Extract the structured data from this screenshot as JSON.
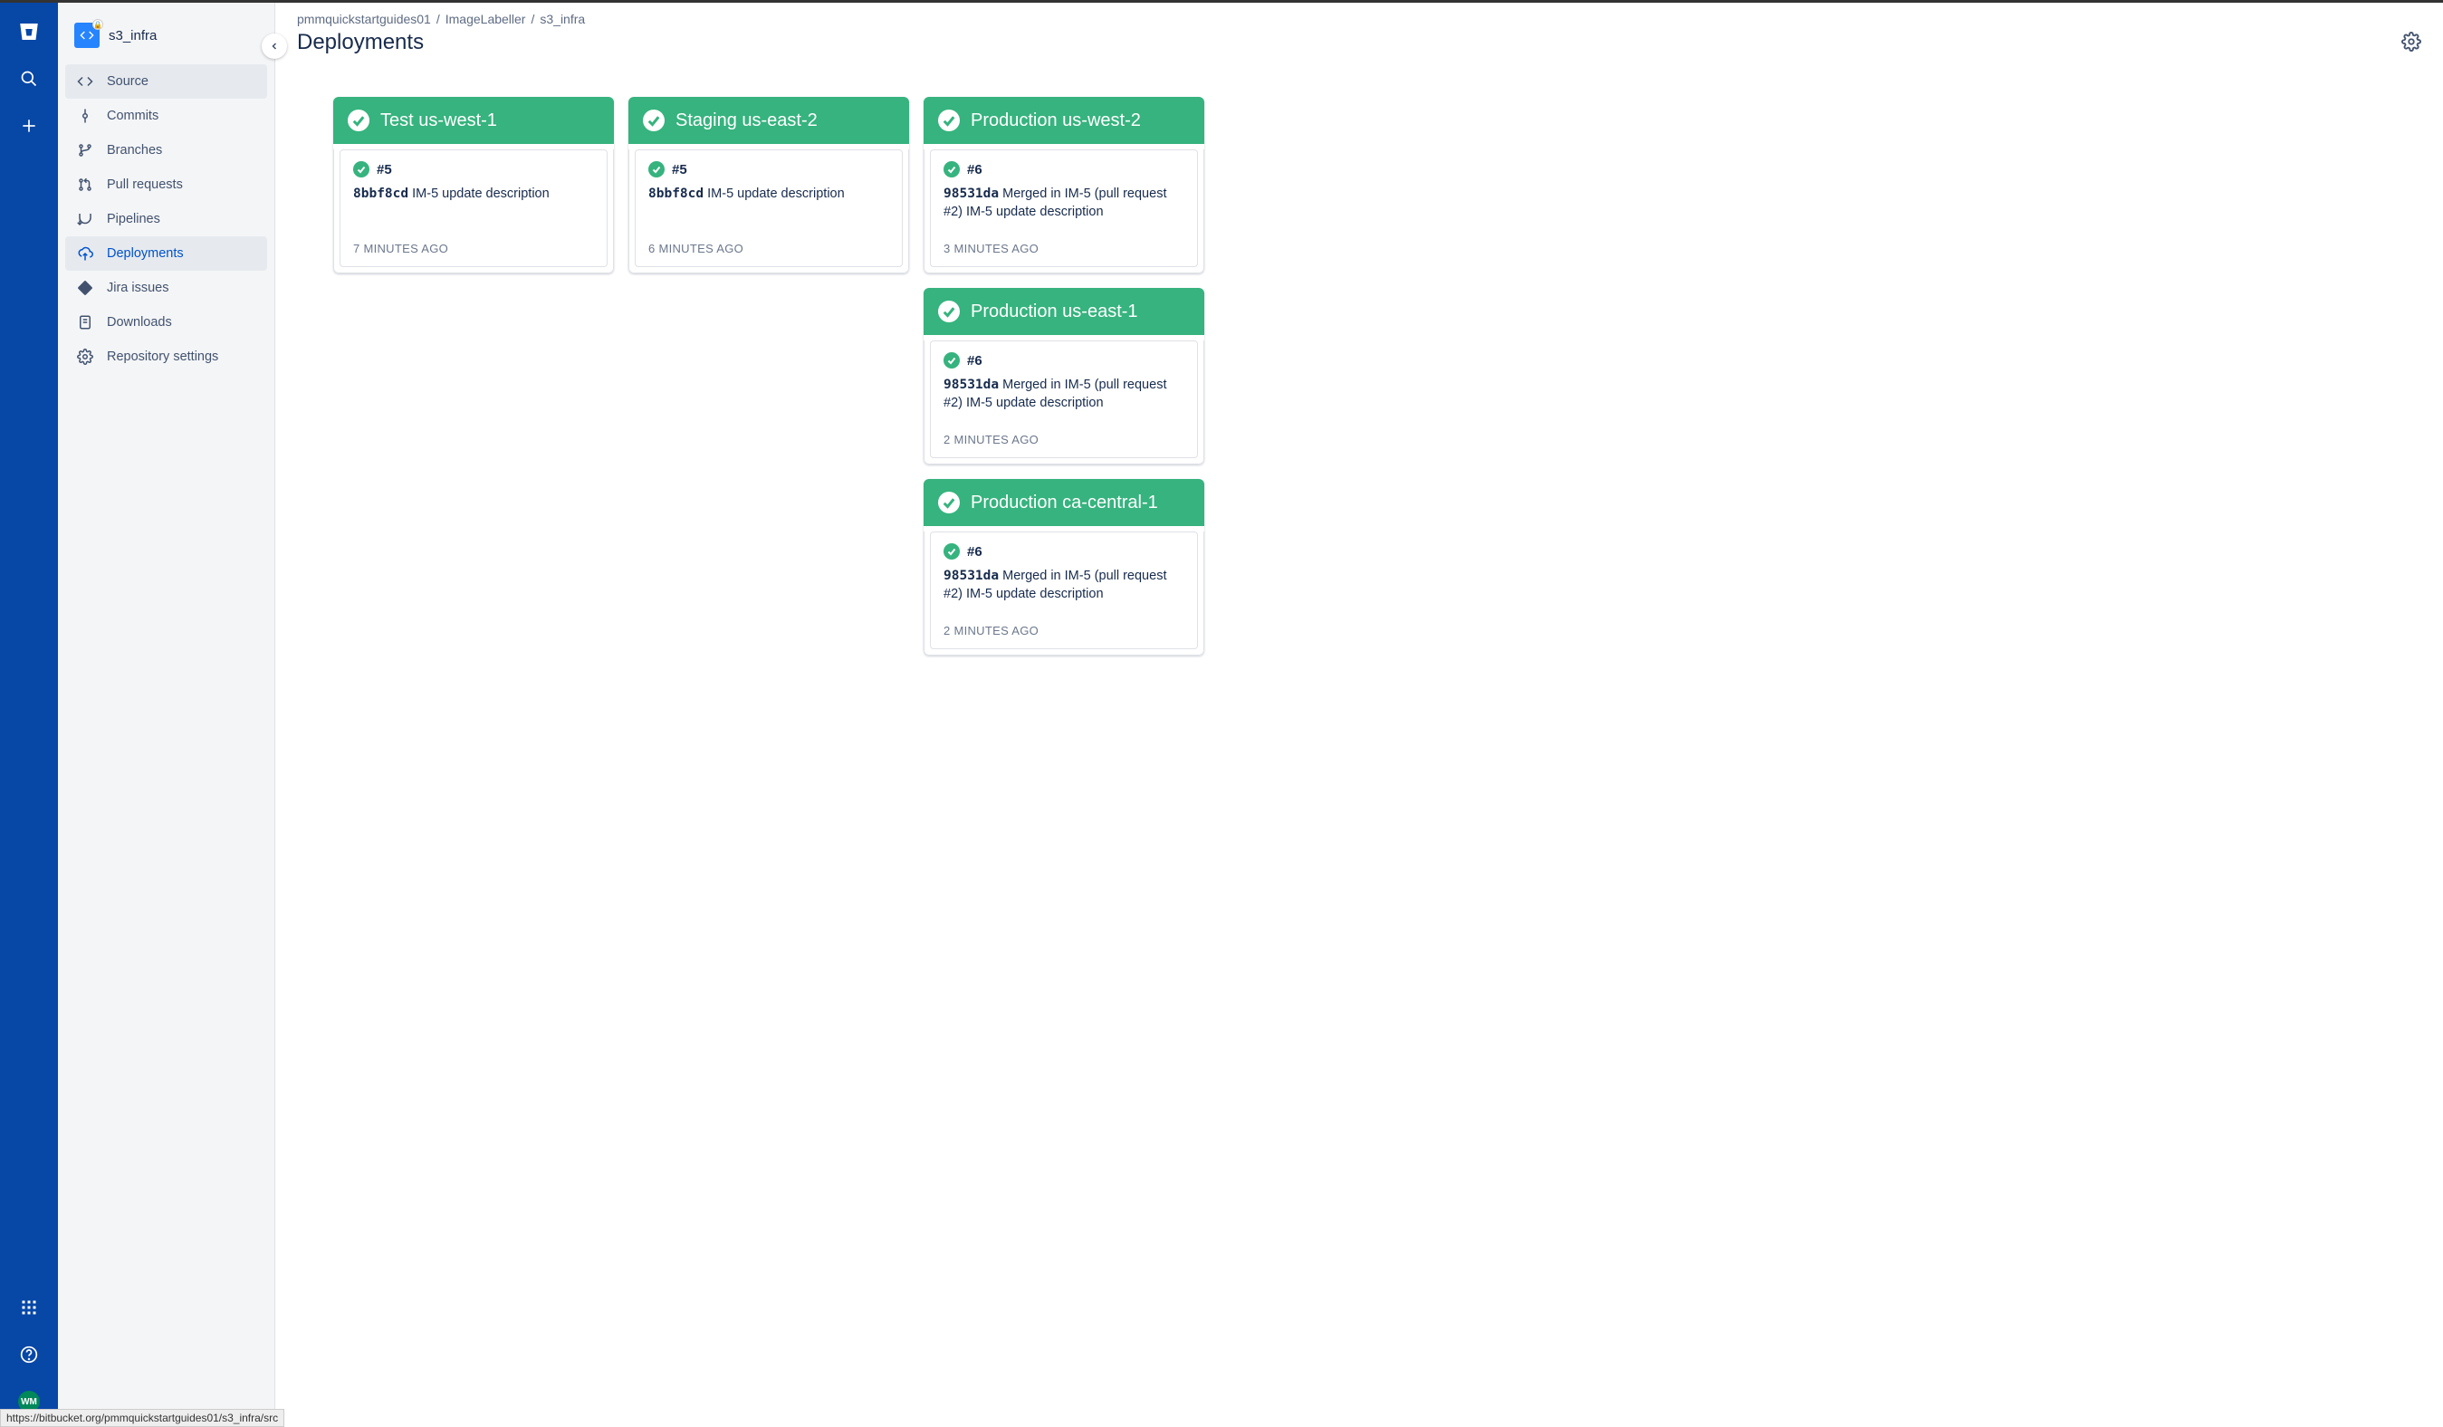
{
  "global_nav": {
    "avatar_initials": "WM"
  },
  "sidebar": {
    "repo_name": "s3_infra",
    "items": [
      {
        "label": "Source",
        "icon": "code"
      },
      {
        "label": "Commits",
        "icon": "commit"
      },
      {
        "label": "Branches",
        "icon": "branch"
      },
      {
        "label": "Pull requests",
        "icon": "pr"
      },
      {
        "label": "Pipelines",
        "icon": "pipeline"
      },
      {
        "label": "Deployments",
        "icon": "deploy"
      },
      {
        "label": "Jira issues",
        "icon": "jira"
      },
      {
        "label": "Downloads",
        "icon": "download"
      },
      {
        "label": "Repository settings",
        "icon": "gear"
      }
    ]
  },
  "breadcrumb": {
    "parts": [
      "pmmquickstartguides01",
      "ImageLabeller",
      "s3_infra"
    ]
  },
  "page": {
    "title": "Deployments"
  },
  "columns": [
    {
      "envs": [
        {
          "name": "Test us-west-1",
          "build": "#5",
          "hash": "8bbf8cd",
          "message": "IM-5 update description",
          "time": "7 MINUTES AGO"
        }
      ]
    },
    {
      "envs": [
        {
          "name": "Staging us-east-2",
          "build": "#5",
          "hash": "8bbf8cd",
          "message": "IM-5 update description",
          "time": "6 MINUTES AGO"
        }
      ]
    },
    {
      "envs": [
        {
          "name": "Production us-west-2",
          "build": "#6",
          "hash": "98531da",
          "message": "Merged in IM-5 (pull request #2) IM-5 update description",
          "time": "3 MINUTES AGO"
        },
        {
          "name": "Production us-east-1",
          "build": "#6",
          "hash": "98531da",
          "message": "Merged in IM-5 (pull request #2) IM-5 update description",
          "time": "2 MINUTES AGO"
        },
        {
          "name": "Production ca-central-1",
          "build": "#6",
          "hash": "98531da",
          "message": "Merged in IM-5 (pull request #2) IM-5 update description",
          "time": "2 MINUTES AGO"
        }
      ]
    }
  ],
  "status_bar": "https://bitbucket.org/pmmquickstartguides01/s3_infra/src"
}
